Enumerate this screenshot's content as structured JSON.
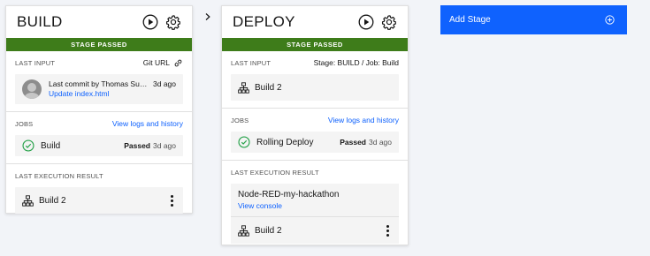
{
  "stages": [
    {
      "title": "BUILD",
      "status_banner": "STAGE PASSED",
      "last_input": {
        "label": "LAST INPUT",
        "source": "Git URL",
        "commit_author_line": "Last commit by Thomas Suedbro...",
        "commit_time": "3d ago",
        "commit_message": "Update index.html"
      },
      "jobs": {
        "label": "JOBS",
        "link": "View logs and history",
        "job_name": "Build",
        "job_status": "Passed",
        "job_time": "3d ago"
      },
      "last_execution": {
        "label": "LAST EXECUTION RESULT",
        "build_name": "Build 2"
      }
    },
    {
      "title": "DEPLOY",
      "status_banner": "STAGE PASSED",
      "last_input": {
        "label": "LAST INPUT",
        "source": "Stage: BUILD  /  Job: Build",
        "build_name": "Build 2"
      },
      "jobs": {
        "label": "JOBS",
        "link": "View logs and history",
        "job_name": "Rolling Deploy",
        "job_status": "Passed",
        "job_time": "3d ago"
      },
      "last_execution": {
        "label": "LAST EXECUTION RESULT",
        "app_name": "Node-RED-my-hackathon",
        "console_link": "View console",
        "build_name": "Build 2"
      }
    }
  ],
  "add_stage": {
    "label": "Add Stage"
  },
  "colors": {
    "passed_green": "#3e7c1a",
    "primary_blue": "#0f62fe",
    "success_icon": "#24a148"
  },
  "icons": [
    "play-icon",
    "gear-icon",
    "link-icon",
    "checkmark-circle-icon",
    "build-tree-icon",
    "kebab-menu-icon",
    "chevron-right-icon",
    "add-circle-icon"
  ]
}
